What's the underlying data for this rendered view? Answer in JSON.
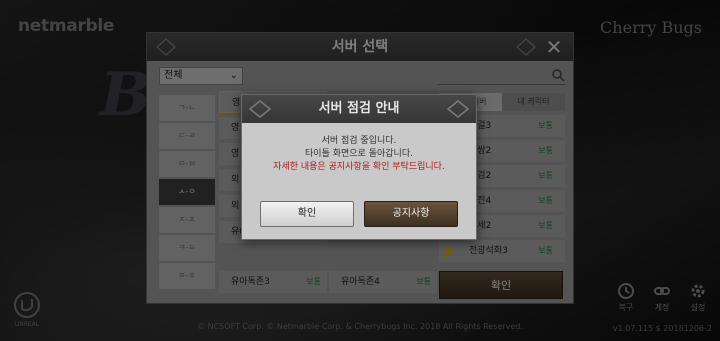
{
  "brand": {
    "left": "netmarble",
    "right": "Cherry Bugs"
  },
  "footer": {
    "copyright": "© NCSOFT Corp. © Netmarble Corp. & Cherrybugs Inc. 2018 All Rights Reserved.",
    "version": "v1.07.115 $ 20181206-2"
  },
  "corner": {
    "restore": "복구",
    "link": "계정",
    "settings": "설정"
  },
  "server_panel": {
    "title": "서버 선택",
    "filter": "전체",
    "letters": [
      "ㄱ-ㄴ",
      "ㄷ-ㄹ",
      "ㅁ-ㅂ",
      "ㅅ-ㅇ",
      "ㅈ-ㅊ",
      "ㅋ-ㅌ",
      "ㅍ-ㅎ"
    ],
    "tabs": [
      "전체 서버",
      "내 캐릭터"
    ],
    "grid": [
      {
        "name": "영",
        "status": ""
      },
      {
        "name": "영",
        "status": ""
      },
      {
        "name": "영",
        "status": ""
      },
      {
        "name": "외",
        "status": ""
      },
      {
        "name": "외",
        "status": ""
      },
      {
        "name": "유0",
        "status": ""
      },
      {
        "name": "유아독존3",
        "status": "보통"
      },
      {
        "name": "유아독존4",
        "status": "보통"
      }
    ],
    "list": [
      {
        "name": "단걸3",
        "status": "보통"
      },
      {
        "name": "무쌍2",
        "status": "보통"
      },
      {
        "name": "다검2",
        "status": "보통"
      },
      {
        "name": "허전4",
        "status": "보통"
      },
      {
        "name": "뜨세2",
        "status": "보통"
      },
      {
        "name": "전광석화3",
        "status": "보통"
      }
    ],
    "confirm": "확인"
  },
  "modal": {
    "title": "서버 점검 안내",
    "line1": "서버 점검 중입니다.",
    "line2": "타이틀 화면으로 돌아갑니다.",
    "warning": "자세한 내용은 공지사항을 확인 부탁드립니다.",
    "ok": "확인",
    "notice": "공지사항"
  }
}
